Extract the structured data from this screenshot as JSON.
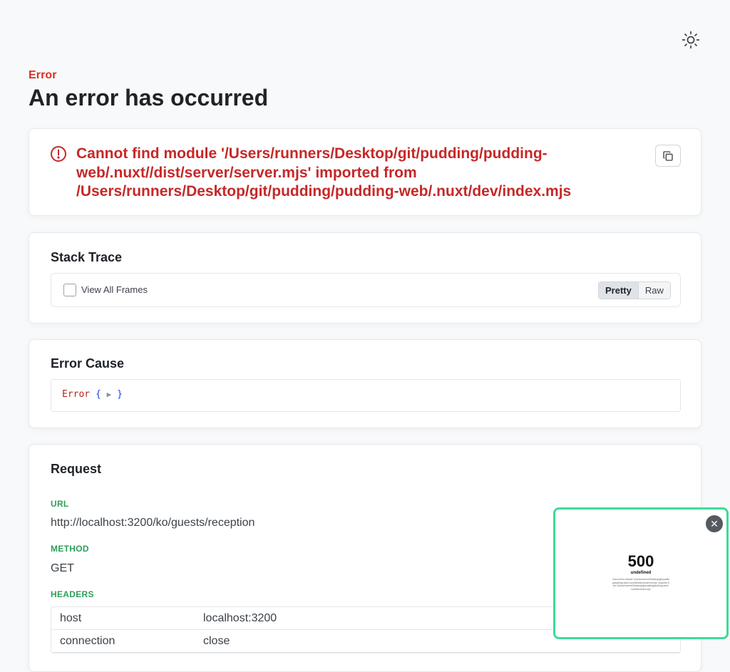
{
  "header": {
    "eyebrow": "Error",
    "title": "An error has occurred",
    "theme_toggle_icon": "sun-icon"
  },
  "message": {
    "icon": "alert-circle-icon",
    "text": "Cannot find module '/Users/runners/Desktop/git/pudding/pudding-web/.nuxt//dist/server/server.mjs' imported from /Users/runners/Desktop/git/pudding/pudding-web/.nuxt/dev/index.mjs",
    "copy_icon": "copy-icon",
    "color": "#c62828"
  },
  "stack_trace": {
    "title": "Stack Trace",
    "view_all_label": "View All Frames",
    "view_all_checked": false,
    "modes": [
      "Pretty",
      "Raw"
    ],
    "active_mode": "Pretty"
  },
  "error_cause": {
    "title": "Error Cause",
    "name": "Error",
    "open_brace": "{",
    "arrow": "▶",
    "close_brace": "}"
  },
  "request": {
    "title": "Request",
    "url_label": "URL",
    "url": "http://localhost:3200/ko/guests/reception",
    "method_label": "METHOD",
    "method": "GET",
    "headers_label": "HEADERS",
    "headers": [
      {
        "key": "host",
        "value": "localhost:3200"
      },
      {
        "key": "connection",
        "value": "close"
      }
    ],
    "label_color": "#2e9e5b"
  },
  "preview": {
    "code": "500",
    "subtitle": "undefined",
    "message": "Cannot find module '/Users/runners/Desktop/git/pudding/pudding-web/.nuxt//dist/server/server.mjs' imported from /Users/runners/Desktop/git/pudding/pudding-web/.nuxt/dev/index.mjs",
    "close_icon": "close-icon",
    "border_color": "#3ddc97"
  }
}
